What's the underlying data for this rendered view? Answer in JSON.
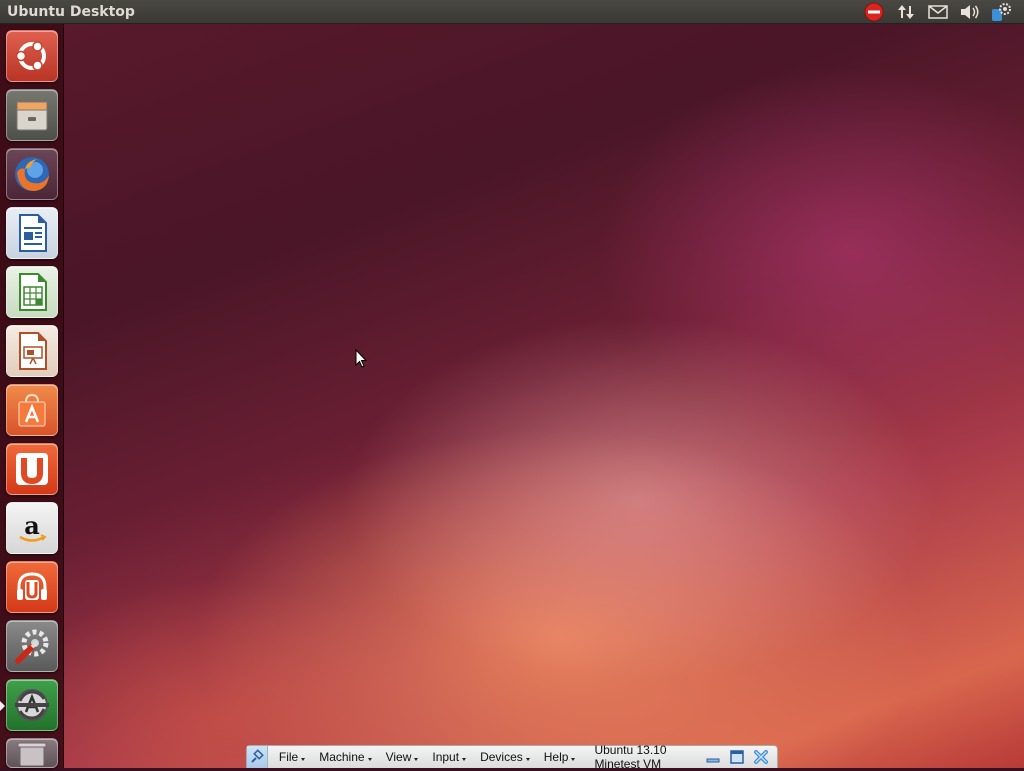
{
  "top_panel": {
    "title": "Ubuntu Desktop",
    "indicators": [
      "session-stop-icon",
      "network-arrows-icon",
      "mail-icon",
      "volume-icon",
      "system-gear-icon"
    ]
  },
  "launcher": {
    "items": [
      {
        "name": "dash-home",
        "icon": "ubuntu-logo-icon",
        "color": "#d04a3a"
      },
      {
        "name": "files",
        "icon": "file-cabinet-icon",
        "color": "#c9c4bb"
      },
      {
        "name": "firefox",
        "icon": "firefox-icon",
        "color": "#5a3a4a"
      },
      {
        "name": "libreoffice-writer",
        "icon": "writer-document-icon",
        "color": "#e9eef5"
      },
      {
        "name": "libreoffice-calc",
        "icon": "calc-spreadsheet-icon",
        "color": "#e9f2e6"
      },
      {
        "name": "libreoffice-impress",
        "icon": "impress-presentation-icon",
        "color": "#f4ebe3"
      },
      {
        "name": "ubuntu-software-center",
        "icon": "shopping-bag-icon",
        "color": "#e5662f"
      },
      {
        "name": "ubuntu-one",
        "icon": "ubuntu-one-icon",
        "color": "#e34a26"
      },
      {
        "name": "amazon",
        "icon": "amazon-icon",
        "color": "#f2f2f2"
      },
      {
        "name": "ubuntu-one-music",
        "icon": "headphones-icon",
        "color": "#e04a28"
      },
      {
        "name": "system-settings",
        "icon": "settings-wrench-icon",
        "color": "#7a7a7a"
      },
      {
        "name": "software-updater",
        "icon": "software-updater-icon",
        "color": "#2f8a3a"
      },
      {
        "name": "trash",
        "icon": "trash-icon",
        "color": "#8a7c80"
      }
    ]
  },
  "vbox": {
    "menus": [
      "File",
      "Machine",
      "View",
      "Input",
      "Devices",
      "Help"
    ],
    "vm_title": "Ubuntu 13.10 Minetest VM"
  },
  "colors": {
    "panel_bg": "#3c3b37",
    "launcher_bg": "#3c0c16",
    "accent": "#dd4814"
  }
}
